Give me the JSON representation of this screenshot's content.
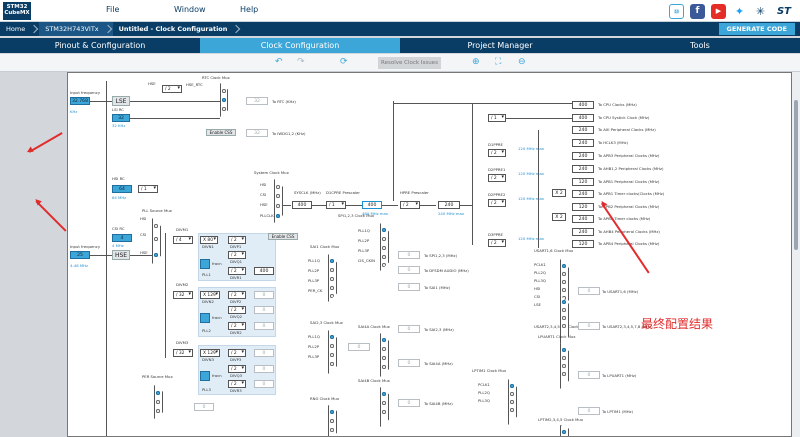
{
  "app": {
    "logo_line1": "STM32",
    "logo_line2": "CubeMX"
  },
  "menu": {
    "file": "File",
    "window": "Window",
    "help": "Help"
  },
  "breadcrumb": {
    "home": "Home",
    "device": "STM32H743VITx",
    "current": "Untitled - Clock Configuration"
  },
  "generate_label": "GENERATE CODE",
  "tabs": [
    "Pinout & Configuration",
    "Clock Configuration",
    "Project Manager",
    "Tools"
  ],
  "toolbar": {
    "resolve_label": "Resolve Clock Issues"
  },
  "brand_icons": [
    "anniversary-icon",
    "facebook-icon",
    "youtube-icon",
    "twitter-icon",
    "network-icon",
    "st-logo-icon"
  ],
  "colors": {
    "accent": "#3da6d8",
    "navy": "#0a3d66",
    "annotation": "#e12c2c"
  },
  "diagram": {
    "lse_input": {
      "label": "Input frequency",
      "value": "32.768",
      "range": "KHz"
    },
    "lse_label": "LSE",
    "lsi_label": "LSI RC",
    "lsi_value": "32",
    "lsi_unit": "32 KHz",
    "hse_div": "HSE",
    "hse_rtc_div": "/ 2",
    "hse_rtc_label": "HSE_RTC",
    "rtc_mux_label": "RTC Clock Mux",
    "rtc_out": "32",
    "rtc_out_label": "To RTC (KHz)",
    "iwdg_out": "32",
    "iwdg_out_label": "To IWDG1,2 (KHz)",
    "enable_css": "Enable CSS",
    "hsi_label": "HSI RC",
    "hsi_value": "64",
    "hsi_unit": "64 MHz",
    "hsi_div": "/ 1",
    "csi_label": "CSI RC",
    "csi_value": "4",
    "csi_unit": "4 MHz",
    "pll_mux_label": "PLL Source Mux",
    "hse_input": {
      "label": "Input frequency",
      "value": "25",
      "range": "4-48 MHz"
    },
    "hse_label": "HSE",
    "divm1": "/ 4",
    "divm2": "/ 32",
    "divm3": "/ 32",
    "divm1_label": "DIVM1",
    "divm2_label": "DIVM2",
    "divm3_label": "DIVM3",
    "mul1": "X 80",
    "mul2": "X 129",
    "mul3": "X 129",
    "divn1_label": "DIVN1",
    "divn2_label": "DIVN2",
    "divn3_label": "DIVN3",
    "fracn_label": "fracn",
    "pll1_label": "PLL1",
    "pll2_label": "PLL2",
    "pll3_label": "PLL3",
    "divp_val": "/ 2",
    "divq_val": "/ 2",
    "divr_val": "/ 2",
    "divp_label": "DIVP1",
    "divq_label": "DIVQ1",
    "divr_label": "DIVR1",
    "divp2_label": "DIVP2",
    "divq2_label": "DIVQ2",
    "divr2_label": "DIVR2",
    "divp3_label": "DIVP3",
    "divq3_label": "DIVQ3",
    "divr3_label": "DIVR3",
    "pll1r_value": "400",
    "sys_mux_label": "System Clock Mux",
    "sys_mux_inputs": [
      "HSI",
      "CSI",
      "HSE",
      "PLLCLK"
    ],
    "sysclk_label": "SYSCLK (MHz)",
    "sysclk_value": "400",
    "d1cpre_label": "D1CPRE Prescaler",
    "d1cpre_value": "/ 1",
    "d1_freq": "400",
    "d1_max": "480 MHz max",
    "hpre_label": "HPRE Prescaler",
    "hpre_value": "/ 2",
    "hclk_value": "240",
    "hclk_max": "240 MHz max",
    "cpu_div": "/ 1",
    "outputs": [
      {
        "value": "400",
        "label": "To CPU Clocks (MHz)"
      },
      {
        "value": "400",
        "label": "To CPU Systick Clock (MHz)"
      },
      {
        "value": "240",
        "label": "To AXI Peripheral Clocks (MHz)"
      },
      {
        "value": "240",
        "label": "To HCLK3 (MHz)"
      },
      {
        "value": "240",
        "label": "To APB3 Peripheral Clocks (MHz)"
      },
      {
        "value": "240",
        "label": "To AHB1,2 Peripheral Clocks (MHz)"
      },
      {
        "value": "120",
        "label": "To APB1 Peripheral Clocks (MHz)"
      },
      {
        "value": "240",
        "label": "To APB1 Timer clocks(Clocks (MHz)"
      },
      {
        "value": "120",
        "label": "To APB2 Peripheral Clocks (MHz)"
      },
      {
        "value": "240",
        "label": "To APB2 Timer clocks (MHz)"
      },
      {
        "value": "240",
        "label": "To AHB4 Peripheral Clocks (MHz)"
      },
      {
        "value": "120",
        "label": "To APB4 Peripheral Clocks (MHz)"
      }
    ],
    "d1ppre": "D1PPRE",
    "d2ppre1": "D2PPRE1",
    "d2ppre2": "D2PPRE2",
    "d3ppre": "D3PPRE",
    "ppre_val": "/ 2",
    "x2": "X 2",
    "max_120": "120 MHz max",
    "spi_mux": "SPI1,2,3 Clock Mux",
    "spi_out": "To SPI1,2,3 (MHz)",
    "sai1_mux": "SAI1 Clock Mux",
    "dfsdm_out": "To DFSDM AUDIO (MHz)",
    "sai1_out": "To SAI1 (MHz)",
    "sai23_mux": "SAI2,3 Clock Mux",
    "sai23_out": "To SAI2,3 (MHz)",
    "sai4a_mux": "SAI4A Clock Mux",
    "sai4a_out": "To SAI4A (MHz)",
    "sai4b_mux": "SAI4B Clock Mux",
    "sai4b_out": "To SAI4B (MHz)",
    "rng_mux": "RNG Clock Mux",
    "per_mux": "PER Source Mux",
    "mux_inputs_pll": [
      "PLL1Q",
      "PLL2P",
      "PLL3P",
      "I2S_CKIN",
      "PER_CK"
    ],
    "usart1_mux": "USART1,6 Clock Mux",
    "usart1_out": "To USART1,6 (MHz)",
    "usart2_mux": "USART2,3,4,5,7,8 Clock Mux",
    "usart2_out": "To USART2,3,4,5,7,8 (MHz)",
    "lpuart_mux": "LPUART1 Clock Mux",
    "lpuart_out": "To LPUART1 (MHz)",
    "lptim1_mux": "LPTIM1 Clock Mux",
    "lptim1_out": "To LPTIM1 (MHz)",
    "lptim2_mux": "LPTIM2,3,4,5 Clock Mux",
    "uart_inputs": [
      "PCLK1",
      "PLL2Q",
      "PLL3Q",
      "HSI",
      "CSI",
      "LSE"
    ],
    "hidden_val": "0",
    "per_ck": "PER_CK",
    "hse_in": "HSE",
    "hsi_in": "HSI",
    "csi_in": "CSI"
  },
  "annotation_text": "最终配置结果"
}
